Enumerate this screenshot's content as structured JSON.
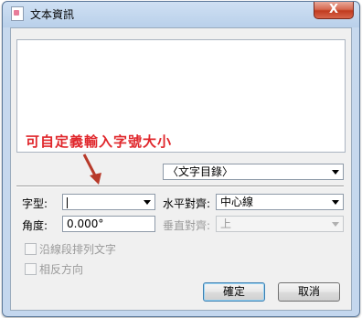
{
  "window": {
    "title": "文本資訊",
    "close_label": "X"
  },
  "annotation": {
    "text": "可自定義輸入字號大小"
  },
  "text_list": {
    "selected": "〈文字目錄〉"
  },
  "font": {
    "label": "字型:",
    "value": ""
  },
  "horizontal_align": {
    "label": "水平對齊:",
    "value": "中心線"
  },
  "angle": {
    "label": "角度:",
    "value": "0.000°"
  },
  "vertical_align": {
    "label": "垂直對齊:",
    "value": "上"
  },
  "options": {
    "along_segment": "沿線段排列文字",
    "reverse": "相反方向"
  },
  "buttons": {
    "ok": "確定",
    "cancel": "取消"
  },
  "colors": {
    "annotation": "#e0262b",
    "arrow": "#b73a2a",
    "close": "#c13b1f"
  }
}
